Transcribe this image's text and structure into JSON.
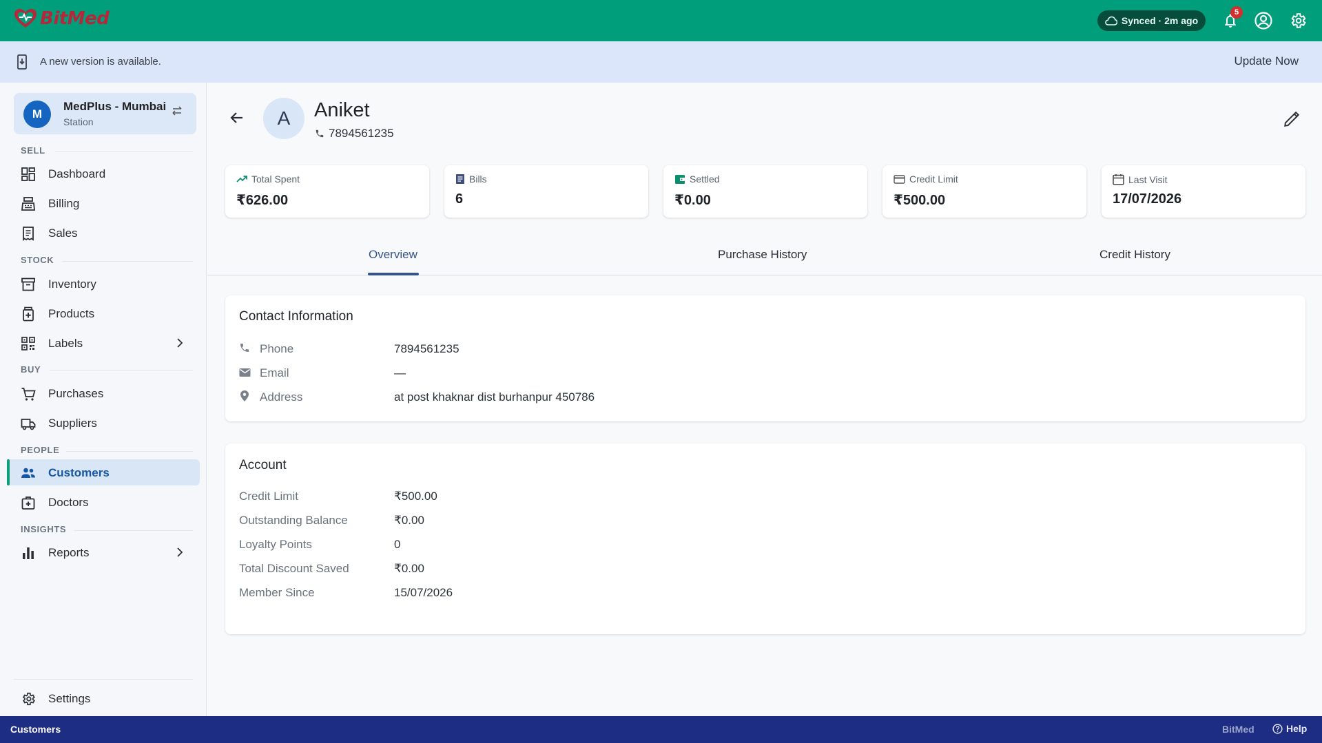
{
  "app": {
    "name": "BitMed"
  },
  "topbar": {
    "sync_status": "Synced · 2m ago",
    "notification_count": "5"
  },
  "banner": {
    "message": "A new version is available.",
    "action": "Update Now"
  },
  "sidebar": {
    "store": {
      "initial": "M",
      "name": "MedPlus - Mumbai",
      "subtitle": "Station"
    },
    "sections": {
      "sell": "SELL",
      "stock": "STOCK",
      "buy": "BUY",
      "people": "PEOPLE",
      "insights": "INSIGHTS"
    },
    "items": {
      "dashboard": "Dashboard",
      "billing": "Billing",
      "sales": "Sales",
      "inventory": "Inventory",
      "products": "Products",
      "labels": "Labels",
      "purchases": "Purchases",
      "suppliers": "Suppliers",
      "customers": "Customers",
      "doctors": "Doctors",
      "reports": "Reports",
      "settings": "Settings"
    },
    "active_item": "customers"
  },
  "customer": {
    "initial": "A",
    "name": "Aniket",
    "phone": "7894561235"
  },
  "stats": [
    {
      "label": "Total Spent",
      "value": "₹626.00",
      "icon": "trending-up-icon"
    },
    {
      "label": "Bills",
      "value": "6",
      "icon": "receipt-icon"
    },
    {
      "label": "Settled",
      "value": "₹0.00",
      "icon": "wallet-icon"
    },
    {
      "label": "Credit Limit",
      "value": "₹500.00",
      "icon": "credit-card-icon"
    },
    {
      "label": "Last Visit",
      "value": "17/07/2026",
      "icon": "calendar-icon"
    }
  ],
  "tabs": [
    {
      "label": "Overview",
      "active": true
    },
    {
      "label": "Purchase History",
      "active": false
    },
    {
      "label": "Credit History",
      "active": false
    }
  ],
  "contact": {
    "title": "Contact Information",
    "phone_label": "Phone",
    "phone_value": "7894561235",
    "email_label": "Email",
    "email_value": "—",
    "address_label": "Address",
    "address_value": "at post khaknar dist burhanpur 450786"
  },
  "account": {
    "title": "Account",
    "rows": [
      {
        "label": "Credit Limit",
        "value": "₹500.00"
      },
      {
        "label": "Outstanding Balance",
        "value": "₹0.00"
      },
      {
        "label": "Loyalty Points",
        "value": "0"
      },
      {
        "label": "Total Discount Saved",
        "value": "₹0.00"
      },
      {
        "label": "Member Since",
        "value": "15/07/2026"
      }
    ]
  },
  "footer": {
    "current_page": "Customers",
    "brand": "BitMed",
    "help": "Help"
  },
  "colors": {
    "primary": "#009e7a",
    "banner": "#dbe6fb",
    "footer": "#1e2d84",
    "accent": "#1565c0"
  }
}
